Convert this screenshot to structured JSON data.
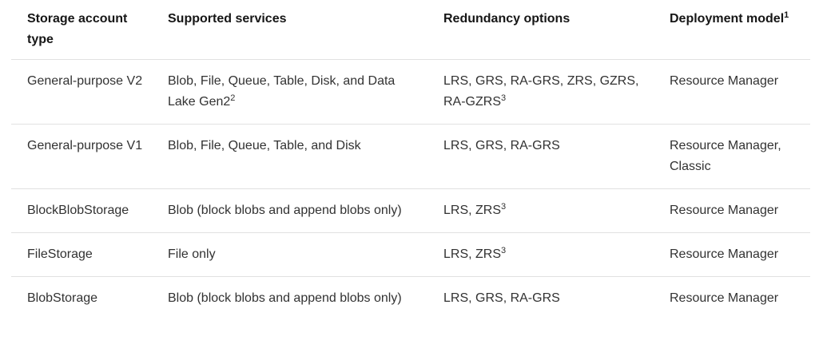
{
  "table": {
    "headers": [
      {
        "text": "Storage account type",
        "sup": ""
      },
      {
        "text": "Supported services",
        "sup": ""
      },
      {
        "text": "Redundancy options",
        "sup": ""
      },
      {
        "text": "Deployment model",
        "sup": "1"
      }
    ],
    "rows": [
      {
        "type": "General-purpose V2",
        "services": "Blob, File, Queue, Table, Disk, and Data Lake Gen2",
        "services_sup": "2",
        "redundancy": "LRS, GRS, RA-GRS, ZRS, GZRS, RA-GZRS",
        "redundancy_sup": "3",
        "deployment": "Resource Manager"
      },
      {
        "type": "General-purpose V1",
        "services": "Blob, File, Queue, Table, and Disk",
        "services_sup": "",
        "redundancy": "LRS, GRS, RA-GRS",
        "redundancy_sup": "",
        "deployment": "Resource Manager, Classic"
      },
      {
        "type": "BlockBlobStorage",
        "services": "Blob (block blobs and append blobs only)",
        "services_sup": "",
        "redundancy": "LRS, ZRS",
        "redundancy_sup": "3",
        "deployment": "Resource Manager"
      },
      {
        "type": "FileStorage",
        "services": "File only",
        "services_sup": "",
        "redundancy": "LRS, ZRS",
        "redundancy_sup": "3",
        "deployment": "Resource Manager"
      },
      {
        "type": "BlobStorage",
        "services": "Blob (block blobs and append blobs only)",
        "services_sup": "",
        "redundancy": "LRS, GRS, RA-GRS",
        "redundancy_sup": "",
        "deployment": "Resource Manager"
      }
    ]
  }
}
